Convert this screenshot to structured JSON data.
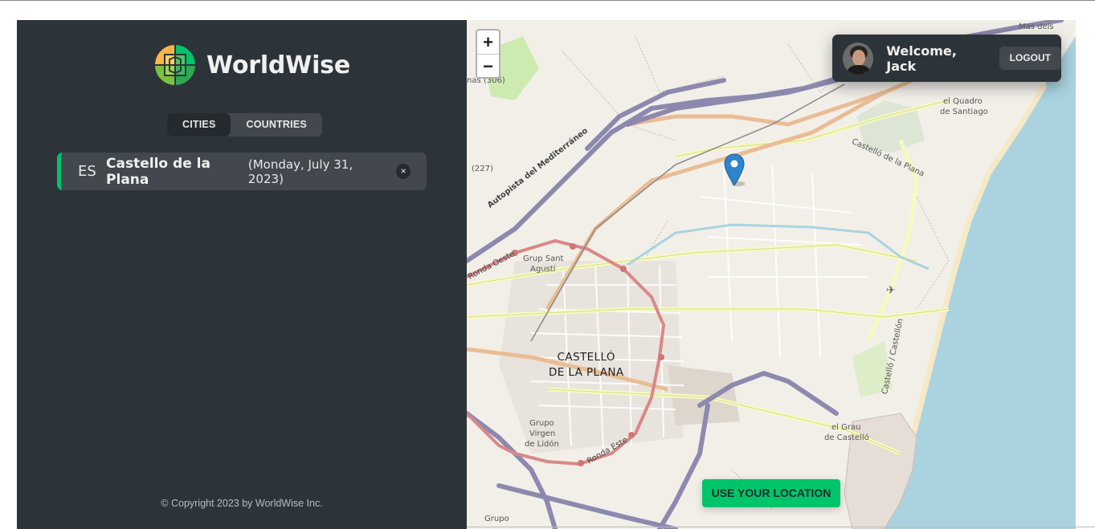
{
  "app": {
    "name": "WorldWise"
  },
  "tabs": [
    {
      "label": "Cities",
      "active": true
    },
    {
      "label": "Countries",
      "active": false
    }
  ],
  "cities": [
    {
      "code": "ES",
      "name": "Castello de la Plana",
      "date": "(Monday, July 31, 2023)",
      "delete_symbol": "×"
    }
  ],
  "footer": {
    "copyright": "© Copyright 2023 by WorldWise Inc."
  },
  "map": {
    "zoom_in": "+",
    "zoom_out": "−",
    "use_location_label": "Use your location",
    "labels": {
      "city": [
        "CASTELLÓ",
        "DE LA PLANA"
      ],
      "grup_sant": "Grup Sant",
      "agusti": "Agustí",
      "grupo": "Grupo",
      "virgen": "Virgen",
      "de_lidon": "de Lidón",
      "el_grau": "el Grau",
      "de_castello": "de Castelló",
      "el_quadro": "el Quadro",
      "de_santiago": "de Santiago",
      "mas_dels": "Mas dels",
      "autopista": "Autopista del Mediterráneo",
      "ronda_oeste": "Ronda Oeste",
      "ronda_este": "Ronda Este",
      "castello_plana": "Castelló de la Plana",
      "castello_castellon": "Castelló / Castellón",
      "num_227": "(227)",
      "num_306": "nas (306)",
      "grupo_bottom": "Grupo"
    }
  },
  "user": {
    "welcome": "Welcome, Jack",
    "logout_label": "Logout"
  },
  "colors": {
    "sidebar_bg": "#2d3439",
    "item_bg": "#42484d",
    "accent_green": "#00c46a",
    "sea": "#aad3df"
  }
}
